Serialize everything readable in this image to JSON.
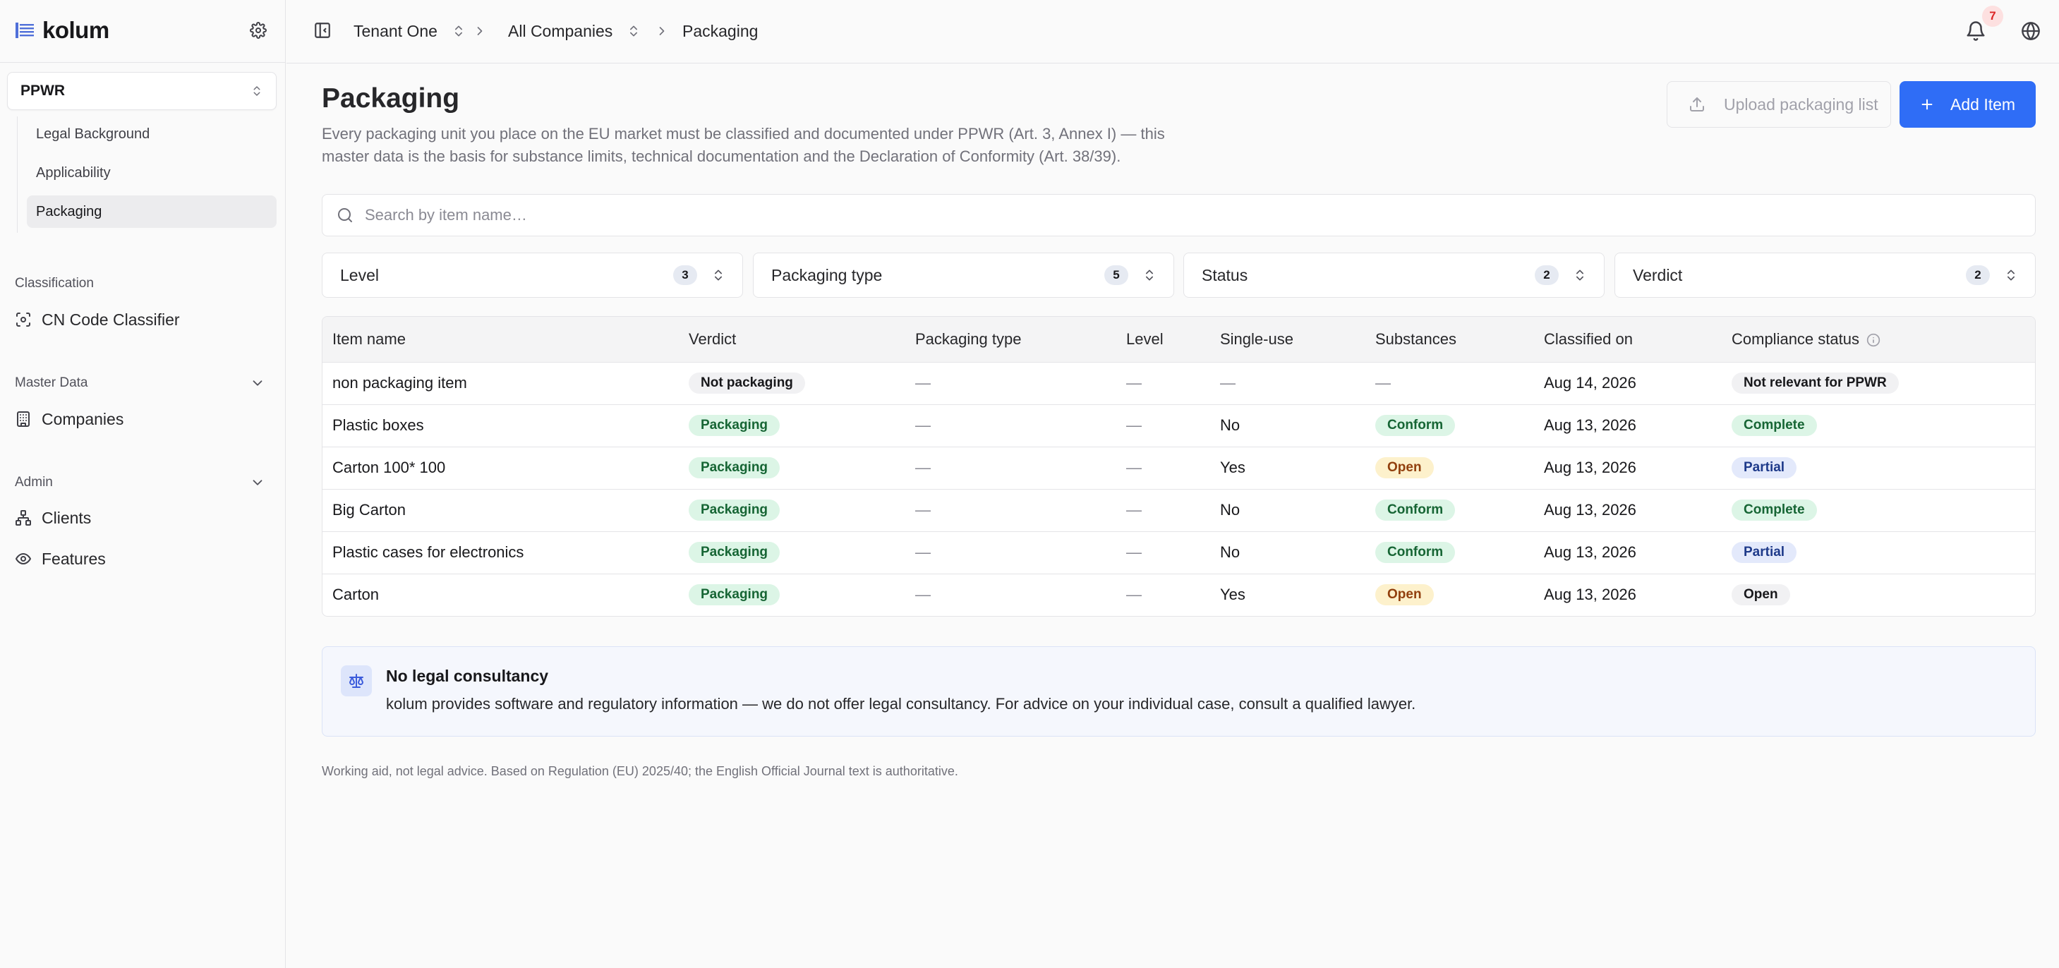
{
  "app": {
    "logo_text": "kolum"
  },
  "sidebar": {
    "module": "PPWR",
    "sub_items": [
      {
        "label": "Legal Background"
      },
      {
        "label": "Applicability"
      },
      {
        "label": "Packaging"
      }
    ],
    "sections": [
      {
        "label": "Classification",
        "items": [
          {
            "label": "CN Code Classifier",
            "icon": "scan-icon"
          }
        ]
      },
      {
        "label": "Master Data",
        "items": [
          {
            "label": "Companies",
            "icon": "building-icon"
          }
        ]
      },
      {
        "label": "Admin",
        "items": [
          {
            "label": "Clients",
            "icon": "network-icon"
          },
          {
            "label": "Features",
            "icon": "eye-icon"
          }
        ]
      }
    ]
  },
  "breadcrumb": {
    "tenant": "Tenant One",
    "company": "All Companies",
    "page": "Packaging"
  },
  "notifications": {
    "count": "7"
  },
  "header": {
    "title": "Packaging",
    "description": "Every packaging unit you place on the EU market must be classified and documented under PPWR (Art. 3, Annex I) — this master data is the basis for substance limits, technical documentation and the Declaration of Conformity (Art. 38/39).",
    "upload_label": "Upload packaging list",
    "add_label": "Add Item"
  },
  "search": {
    "placeholder": "Search by item name…"
  },
  "filters": [
    {
      "label": "Level",
      "count": "3"
    },
    {
      "label": "Packaging type",
      "count": "5"
    },
    {
      "label": "Status",
      "count": "2"
    },
    {
      "label": "Verdict",
      "count": "2"
    }
  ],
  "table": {
    "columns": [
      "Item name",
      "Verdict",
      "Packaging type",
      "Level",
      "Single-use",
      "Substances",
      "Classified on",
      "Compliance status"
    ],
    "rows": [
      {
        "name": "non packaging item",
        "verdict": "Not packaging",
        "packaging_type": "—",
        "level": "—",
        "single_use": "—",
        "substances": "—",
        "classified_on": "Aug 14, 2026",
        "compliance": "Not relevant for PPWR"
      },
      {
        "name": "Plastic boxes",
        "verdict": "Packaging",
        "packaging_type": "—",
        "level": "—",
        "single_use": "No",
        "substances": "Conform",
        "classified_on": "Aug 13, 2026",
        "compliance": "Complete"
      },
      {
        "name": "Carton 100* 100",
        "verdict": "Packaging",
        "packaging_type": "—",
        "level": "—",
        "single_use": "Yes",
        "substances": "Open",
        "classified_on": "Aug 13, 2026",
        "compliance": "Partial"
      },
      {
        "name": "Big Carton",
        "verdict": "Packaging",
        "packaging_type": "—",
        "level": "—",
        "single_use": "No",
        "substances": "Conform",
        "classified_on": "Aug 13, 2026",
        "compliance": "Complete"
      },
      {
        "name": "Plastic cases for electronics",
        "verdict": "Packaging",
        "packaging_type": "—",
        "level": "—",
        "single_use": "No",
        "substances": "Conform",
        "classified_on": "Aug 13, 2026",
        "compliance": "Partial"
      },
      {
        "name": "Carton",
        "verdict": "Packaging",
        "packaging_type": "—",
        "level": "—",
        "single_use": "Yes",
        "substances": "Open",
        "classified_on": "Aug 13, 2026",
        "compliance": "Open"
      }
    ]
  },
  "notice": {
    "title": "No legal consultancy",
    "text": "kolum provides software and regulatory information — we do not offer legal consultancy. For advice on your individual case, consult a qualified lawyer."
  },
  "footnote": "Working aid, not legal advice. Based on Regulation (EU) 2025/40; the English Official Journal text is authoritative.",
  "colors": {
    "accent": "#2f6df6",
    "success_bg": "#dcf5e6",
    "warning_bg": "#fdf1cc",
    "info_bg": "#e3e9fb",
    "badge_red": "#dc2626"
  }
}
